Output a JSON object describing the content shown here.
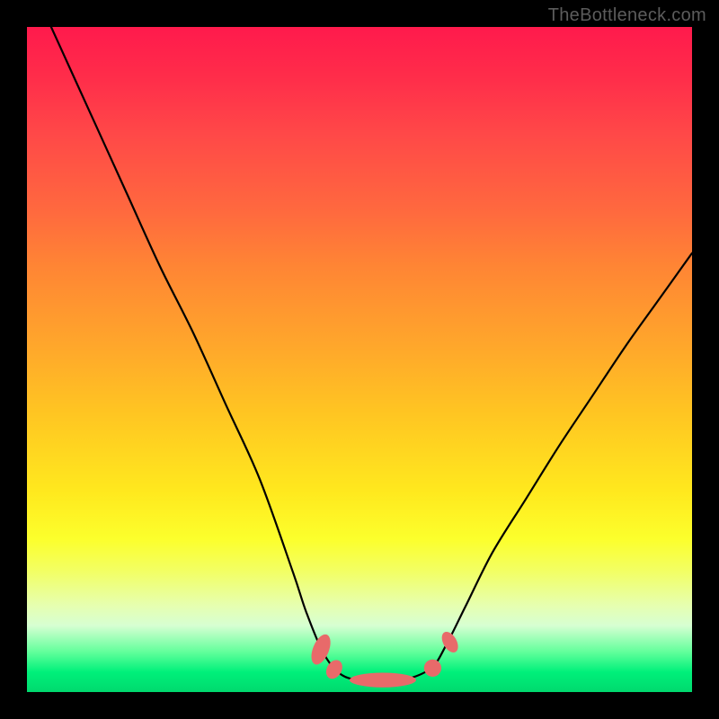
{
  "watermark": "TheBottleneck.com",
  "chart_data": {
    "type": "line",
    "title": "",
    "xlabel": "",
    "ylabel": "",
    "xlim": [
      0,
      1
    ],
    "ylim": [
      0,
      1
    ],
    "series": [
      {
        "name": "curve",
        "x": [
          0.0,
          0.05,
          0.1,
          0.15,
          0.2,
          0.25,
          0.3,
          0.35,
          0.4,
          0.42,
          0.445,
          0.47,
          0.5,
          0.55,
          0.58,
          0.61,
          0.63,
          0.66,
          0.7,
          0.75,
          0.8,
          0.85,
          0.9,
          0.95,
          1.0
        ],
        "values": [
          1.08,
          0.97,
          0.86,
          0.75,
          0.64,
          0.54,
          0.43,
          0.32,
          0.18,
          0.12,
          0.06,
          0.028,
          0.018,
          0.018,
          0.022,
          0.038,
          0.07,
          0.13,
          0.21,
          0.29,
          0.37,
          0.445,
          0.52,
          0.59,
          0.66
        ]
      }
    ],
    "markers": [
      {
        "name": "left-upper-blob",
        "cx": 0.442,
        "cy": 0.064,
        "rx": 0.012,
        "ry": 0.024,
        "rot": 22
      },
      {
        "name": "left-mid-blob",
        "cx": 0.462,
        "cy": 0.034,
        "rx": 0.011,
        "ry": 0.015,
        "rot": 30
      },
      {
        "name": "bottom-long-blob",
        "cx": 0.535,
        "cy": 0.018,
        "rx": 0.05,
        "ry": 0.011,
        "rot": 0
      },
      {
        "name": "right-near-blob",
        "cx": 0.61,
        "cy": 0.036,
        "rx": 0.013,
        "ry": 0.013,
        "rot": 0
      },
      {
        "name": "right-upper-blob",
        "cx": 0.636,
        "cy": 0.075,
        "rx": 0.01,
        "ry": 0.017,
        "rot": -30
      }
    ],
    "colors": {
      "curve_stroke": "#000000",
      "marker_fill": "#e86a6a"
    }
  }
}
